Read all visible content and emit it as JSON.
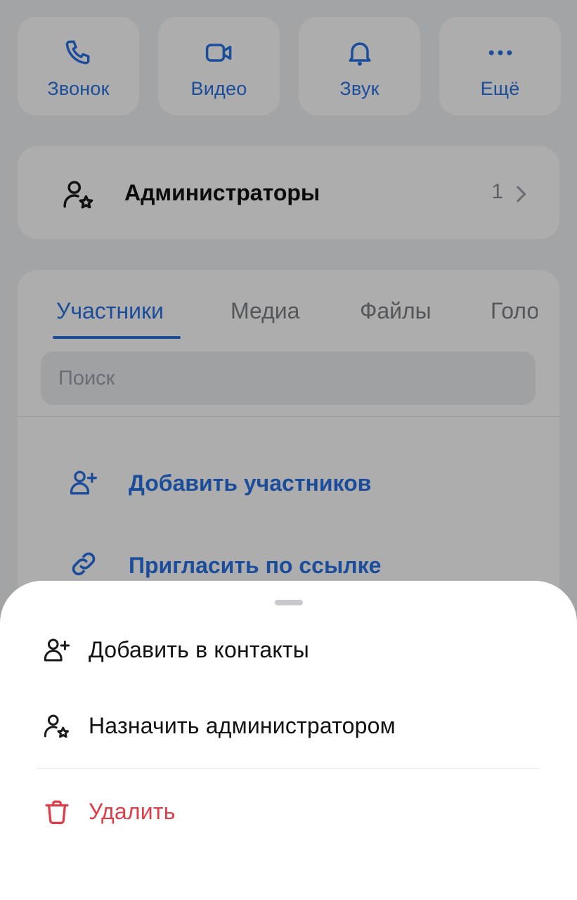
{
  "actions": [
    {
      "label": "Звонок",
      "icon": "phone-icon"
    },
    {
      "label": "Видео",
      "icon": "video-icon"
    },
    {
      "label": "Звук",
      "icon": "bell-icon"
    },
    {
      "label": "Ещё",
      "icon": "more-icon"
    }
  ],
  "admins": {
    "title": "Администраторы",
    "count": "1"
  },
  "tabs": [
    "Участники",
    "Медиа",
    "Файлы",
    "Голосовые"
  ],
  "search": {
    "placeholder": "Поиск"
  },
  "member_actions": [
    {
      "label": "Добавить участников",
      "icon": "add-user-icon"
    },
    {
      "label": "Пригласить по ссылке",
      "icon": "link-icon"
    }
  ],
  "sheet": {
    "items": [
      {
        "label": "Добавить в контакты",
        "icon": "add-user-icon"
      },
      {
        "label": "Назначить администратором",
        "icon": "user-star-icon"
      },
      {
        "label": "Удалить",
        "icon": "trash-icon"
      }
    ]
  },
  "colors": {
    "accent": "#2a72e5",
    "danger": "#e03d4a"
  }
}
